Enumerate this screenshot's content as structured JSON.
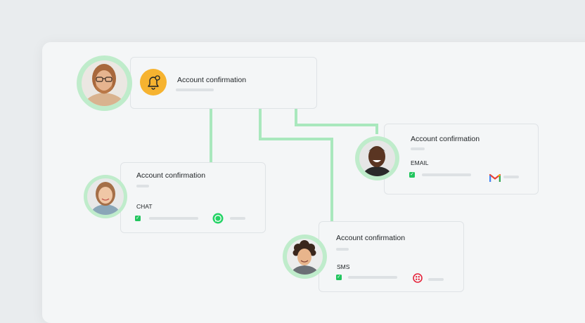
{
  "main_card": {
    "title": "Account confirmation"
  },
  "cards": [
    {
      "id": "chat",
      "title": "Account confirmation",
      "channel": "CHAT",
      "channel_icon": "whatsapp-icon"
    },
    {
      "id": "email",
      "title": "Account confirmation",
      "channel": "EMAIL",
      "channel_icon": "gmail-icon"
    },
    {
      "id": "sms",
      "title": "Account confirmation",
      "channel": "SMS",
      "channel_icon": "twilio-icon"
    }
  ],
  "icons": {
    "main": "bell-icon",
    "check": "checkbox-checked-icon"
  },
  "colors": {
    "connector": "#a9e8bd",
    "avatar_ring": "#bfeccb",
    "bell_bg": "#f6b330",
    "check": "#22c55e",
    "whatsapp": "#25d366",
    "twilio": "#e5243b"
  }
}
